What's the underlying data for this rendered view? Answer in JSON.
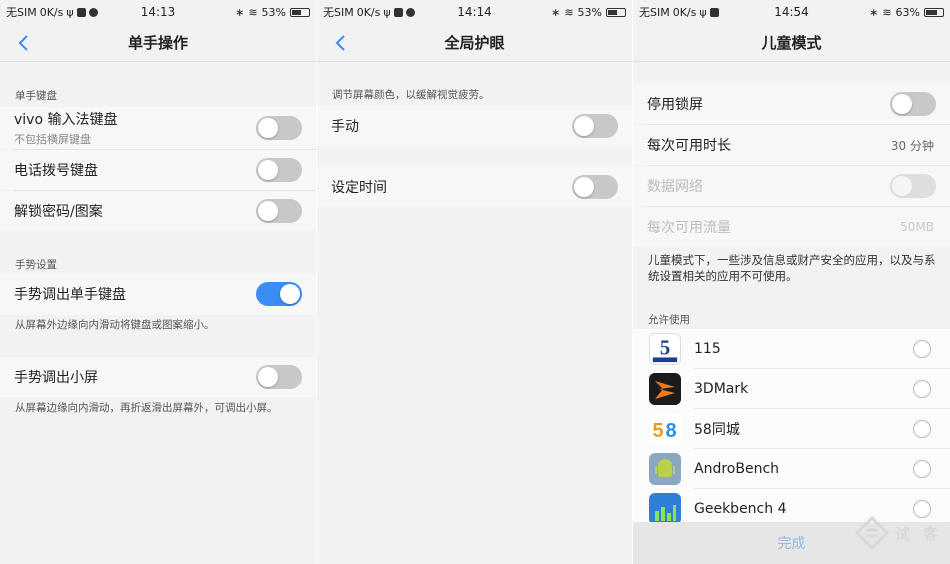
{
  "colors": {
    "accent": "#3a8df3",
    "toggle_off": "#c8c8c8",
    "done": "#8cbbe8"
  },
  "panel1": {
    "status": {
      "carrier": "无SIM",
      "speed": "0K/s",
      "time": "14:13",
      "battery": "53%"
    },
    "title": "单手操作",
    "sections": {
      "keyboard_label": "单手键盘",
      "gesture_label": "手势设置"
    },
    "rows": {
      "vivo_keyboard": {
        "label": "vivo 输入法键盘",
        "sub": "不包括横屏键盘",
        "on": false
      },
      "dial_keyboard": {
        "label": "电话拨号键盘",
        "on": false
      },
      "unlock": {
        "label": "解锁密码/图案",
        "on": false
      },
      "gesture_keyboard": {
        "label": "手势调出单手键盘",
        "on": true
      },
      "gesture_small": {
        "label": "手势调出小屏",
        "on": false
      }
    },
    "desc_keyboard": "从屏幕外边缘向内滑动将键盘或图案缩小。",
    "desc_small": "从屏幕边缘向内滑动，再折返滑出屏幕外，可调出小屏。"
  },
  "panel2": {
    "status": {
      "carrier": "无SIM",
      "speed": "0K/s",
      "time": "14:14",
      "battery": "53%"
    },
    "title": "全局护眼",
    "desc": "调节屏幕颜色，以缓解视觉疲劳。",
    "rows": {
      "manual": {
        "label": "手动",
        "on": false
      },
      "schedule": {
        "label": "设定时间",
        "on": false
      }
    }
  },
  "panel3": {
    "status": {
      "carrier": "无SIM",
      "speed": "0K/s",
      "time": "14:54",
      "battery": "63%"
    },
    "title": "儿童模式",
    "rows": {
      "disable_lock": {
        "label": "停用锁屏",
        "on": false
      },
      "duration": {
        "label": "每次可用时长",
        "value": "30 分钟"
      },
      "data_network": {
        "label": "数据网络",
        "on": false
      },
      "traffic": {
        "label": "每次可用流量",
        "value": "50MB"
      }
    },
    "desc": "儿童模式下，一些涉及信息或财产安全的应用，以及与系统设置相关的应用不可使用。",
    "allow_label": "允许使用",
    "apps": [
      {
        "name": "115",
        "icon": "app-115-icon"
      },
      {
        "name": "3DMark",
        "icon": "app-3dmark-icon"
      },
      {
        "name": "58同城",
        "icon": "app-58-icon"
      },
      {
        "name": "AndroBench",
        "icon": "app-androbench-icon"
      },
      {
        "name": "Geekbench 4",
        "icon": "app-geekbench-icon"
      }
    ],
    "done_label": "完成",
    "watermark": "试 客"
  }
}
